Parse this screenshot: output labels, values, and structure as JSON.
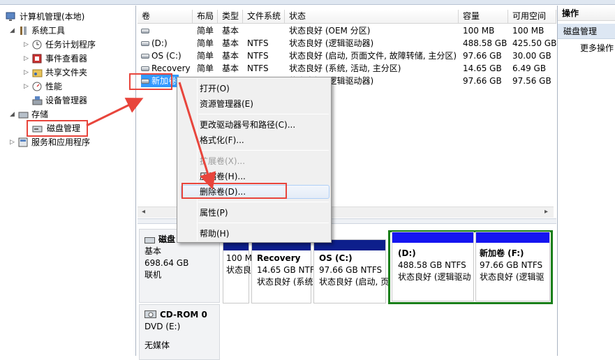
{
  "title": "计算机管理(本地)",
  "tree": {
    "root": "计算机管理(本地)",
    "system_tools": "系统工具",
    "task_scheduler": "任务计划程序",
    "event_viewer": "事件查看器",
    "shared_folders": "共享文件夹",
    "performance": "性能",
    "device_manager": "设备管理器",
    "storage": "存储",
    "disk_management": "磁盘管理",
    "services": "服务和应用程序"
  },
  "columns": [
    "卷",
    "布局",
    "类型",
    "文件系统",
    "状态",
    "容量",
    "可用空间"
  ],
  "volumes": [
    {
      "name": "",
      "layout": "简单",
      "type": "基本",
      "fs": "",
      "status": "状态良好 (OEM 分区)",
      "capacity": "100 MB",
      "free": "100 MB"
    },
    {
      "name": "(D:)",
      "layout": "简单",
      "type": "基本",
      "fs": "NTFS",
      "status": "状态良好 (逻辑驱动器)",
      "capacity": "488.58 GB",
      "free": "425.50 GB"
    },
    {
      "name": "OS (C:)",
      "layout": "简单",
      "type": "基本",
      "fs": "NTFS",
      "status": "状态良好 (启动, 页面文件, 故障转储, 主分区)",
      "capacity": "97.66 GB",
      "free": "30.00 GB"
    },
    {
      "name": "Recovery",
      "layout": "简单",
      "type": "基本",
      "fs": "NTFS",
      "status": "状态良好 (系统, 活动, 主分区)",
      "capacity": "14.65 GB",
      "free": "6.49 GB"
    },
    {
      "name": "新加卷",
      "layout": "",
      "type": "",
      "fs": "",
      "status": "状态良好 (逻辑驱动器)",
      "capacity": "97.66 GB",
      "free": "97.56 GB"
    }
  ],
  "context_menu": {
    "open": "打开(O)",
    "explore": "资源管理器(E)",
    "change_letter": "更改驱动器号和路径(C)...",
    "format": "格式化(F)...",
    "extend": "扩展卷(X)...",
    "shrink": "压缩卷(H)...",
    "delete": "删除卷(D)...",
    "properties": "属性(P)",
    "help": "帮助(H)"
  },
  "disk0": {
    "name": "磁盘 0",
    "type": "基本",
    "size": "698.64 GB",
    "status": "联机",
    "partitions": [
      {
        "line1": "",
        "line2": "100 MB",
        "line3": "状态良好"
      },
      {
        "line1": "Recovery",
        "line2": "14.65 GB NTFS",
        "line3": "状态良好 (系统"
      },
      {
        "line1": "OS  (C:)",
        "line2": "97.66 GB NTFS",
        "line3": "状态良好 (启动, 页"
      },
      {
        "line1": "(D:)",
        "line2": "488.58 GB NTFS",
        "line3": "状态良好 (逻辑驱动"
      },
      {
        "line1": "新加卷  (F:)",
        "line2": "97.66 GB NTFS",
        "line3": "状态良好 (逻辑驱"
      }
    ]
  },
  "cdrom": {
    "name": "CD-ROM 0",
    "drive": "DVD (E:)",
    "status": "无媒体"
  },
  "actions": {
    "header": "操作",
    "section": "磁盘管理",
    "more": "更多操作"
  }
}
